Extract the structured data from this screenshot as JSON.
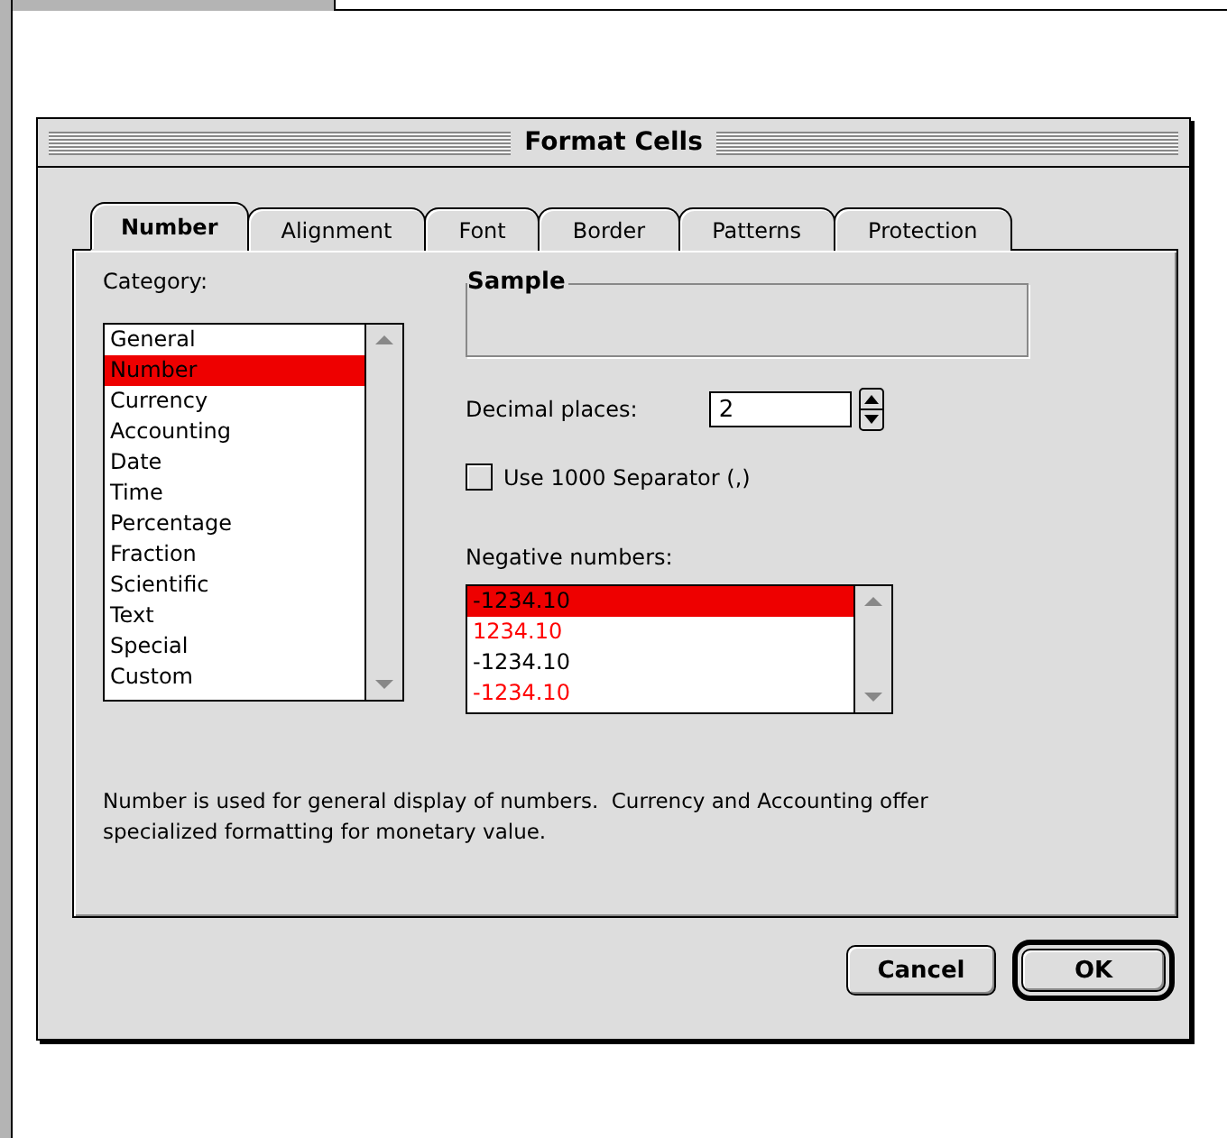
{
  "window": {
    "title": "Format Cells"
  },
  "tabs": [
    {
      "label": "Number",
      "selected": true
    },
    {
      "label": "Alignment",
      "selected": false
    },
    {
      "label": "Font",
      "selected": false
    },
    {
      "label": "Border",
      "selected": false
    },
    {
      "label": "Patterns",
      "selected": false
    },
    {
      "label": "Protection",
      "selected": false
    }
  ],
  "category": {
    "label": "Category:",
    "items": [
      {
        "label": "General",
        "selected": false
      },
      {
        "label": "Number",
        "selected": true
      },
      {
        "label": "Currency",
        "selected": false
      },
      {
        "label": "Accounting",
        "selected": false
      },
      {
        "label": "Date",
        "selected": false
      },
      {
        "label": "Time",
        "selected": false
      },
      {
        "label": "Percentage",
        "selected": false
      },
      {
        "label": "Fraction",
        "selected": false
      },
      {
        "label": "Scientific",
        "selected": false
      },
      {
        "label": "Text",
        "selected": false
      },
      {
        "label": "Special",
        "selected": false
      },
      {
        "label": "Custom",
        "selected": false
      }
    ]
  },
  "sample": {
    "label": "Sample"
  },
  "decimal_places": {
    "label": "Decimal places:",
    "value": "2"
  },
  "separator": {
    "label": "Use 1000 Separator (,)",
    "checked": false
  },
  "negative_numbers": {
    "label": "Negative numbers:",
    "items": [
      {
        "label": "-1234.10",
        "color": "#000000",
        "selected": true
      },
      {
        "label": "1234.10",
        "color": "#ff0000",
        "selected": false
      },
      {
        "label": "-1234.10",
        "color": "#000000",
        "selected": false
      },
      {
        "label": "-1234.10",
        "color": "#ff0000",
        "selected": false
      }
    ]
  },
  "description": "Number is used for general display of numbers.  Currency and Accounting offer specialized formatting for monetary value.",
  "buttons": [
    {
      "label": "Cancel",
      "default": false
    },
    {
      "label": "OK",
      "default": true
    }
  ]
}
